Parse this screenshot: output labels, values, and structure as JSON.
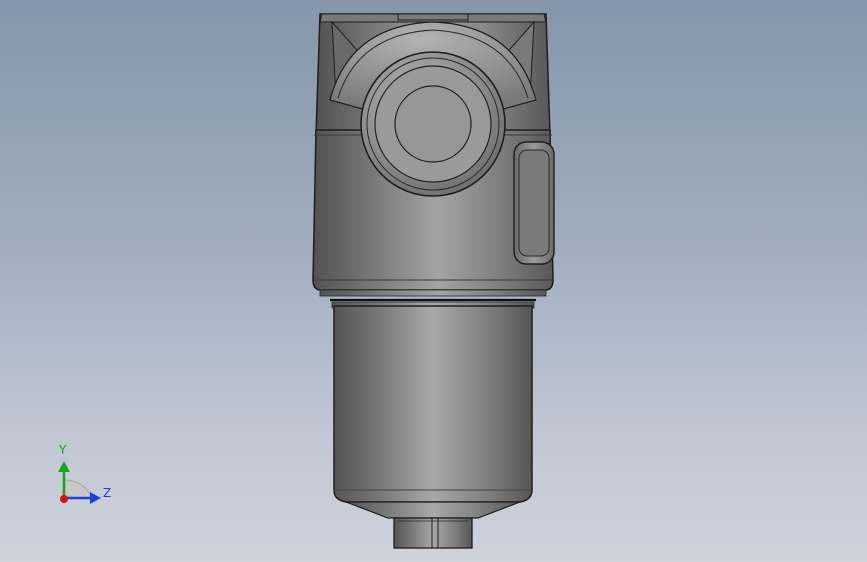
{
  "viewport": {
    "background_top": "#8595ab",
    "background_bottom": "#cdd2db"
  },
  "triad": {
    "y_label": "Y",
    "z_label": "Z",
    "y_color": "#1aa31a",
    "z_color": "#1f3fd6",
    "x_color": "#d01818"
  }
}
